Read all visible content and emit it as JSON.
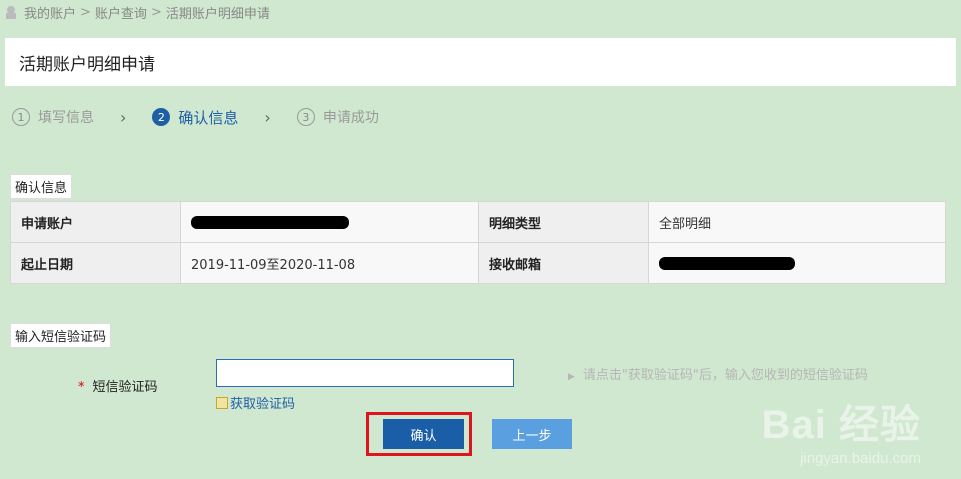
{
  "breadcrumb": {
    "items": [
      "我的账户",
      "账户查询",
      "活期账户明细申请"
    ],
    "separator": ">"
  },
  "page_title": "活期账户明细申请",
  "steps": [
    {
      "num": "1",
      "label": "填写信息",
      "state": "done"
    },
    {
      "num": "2",
      "label": "确认信息",
      "state": "active"
    },
    {
      "num": "3",
      "label": "申请成功",
      "state": "pending"
    }
  ],
  "confirm_section": {
    "title": "确认信息",
    "rows": [
      {
        "k1": "申请账户",
        "v1": "",
        "k2": "明细类型",
        "v2": "全部明细"
      },
      {
        "k1": "起止日期",
        "v1": "2019-11-09至2020-11-08",
        "k2": "接收邮箱",
        "v2": ""
      }
    ]
  },
  "sms_section": {
    "title": "输入短信验证码",
    "required_mark": "*",
    "label": "短信验证码",
    "input_value": "",
    "get_code_label": "获取验证码",
    "hint": "请点击\"获取验证码\"后，输入您收到的短信验证码"
  },
  "buttons": {
    "confirm": "确认",
    "prev": "上一步"
  },
  "watermark": {
    "top": "Bai 经验",
    "bottom": "jingyan.baidu.com"
  },
  "colors": {
    "background": "#cfe8cf",
    "accent": "#1b5ea8",
    "secondary_button": "#5aa0e0",
    "highlight": "#e0141e"
  }
}
